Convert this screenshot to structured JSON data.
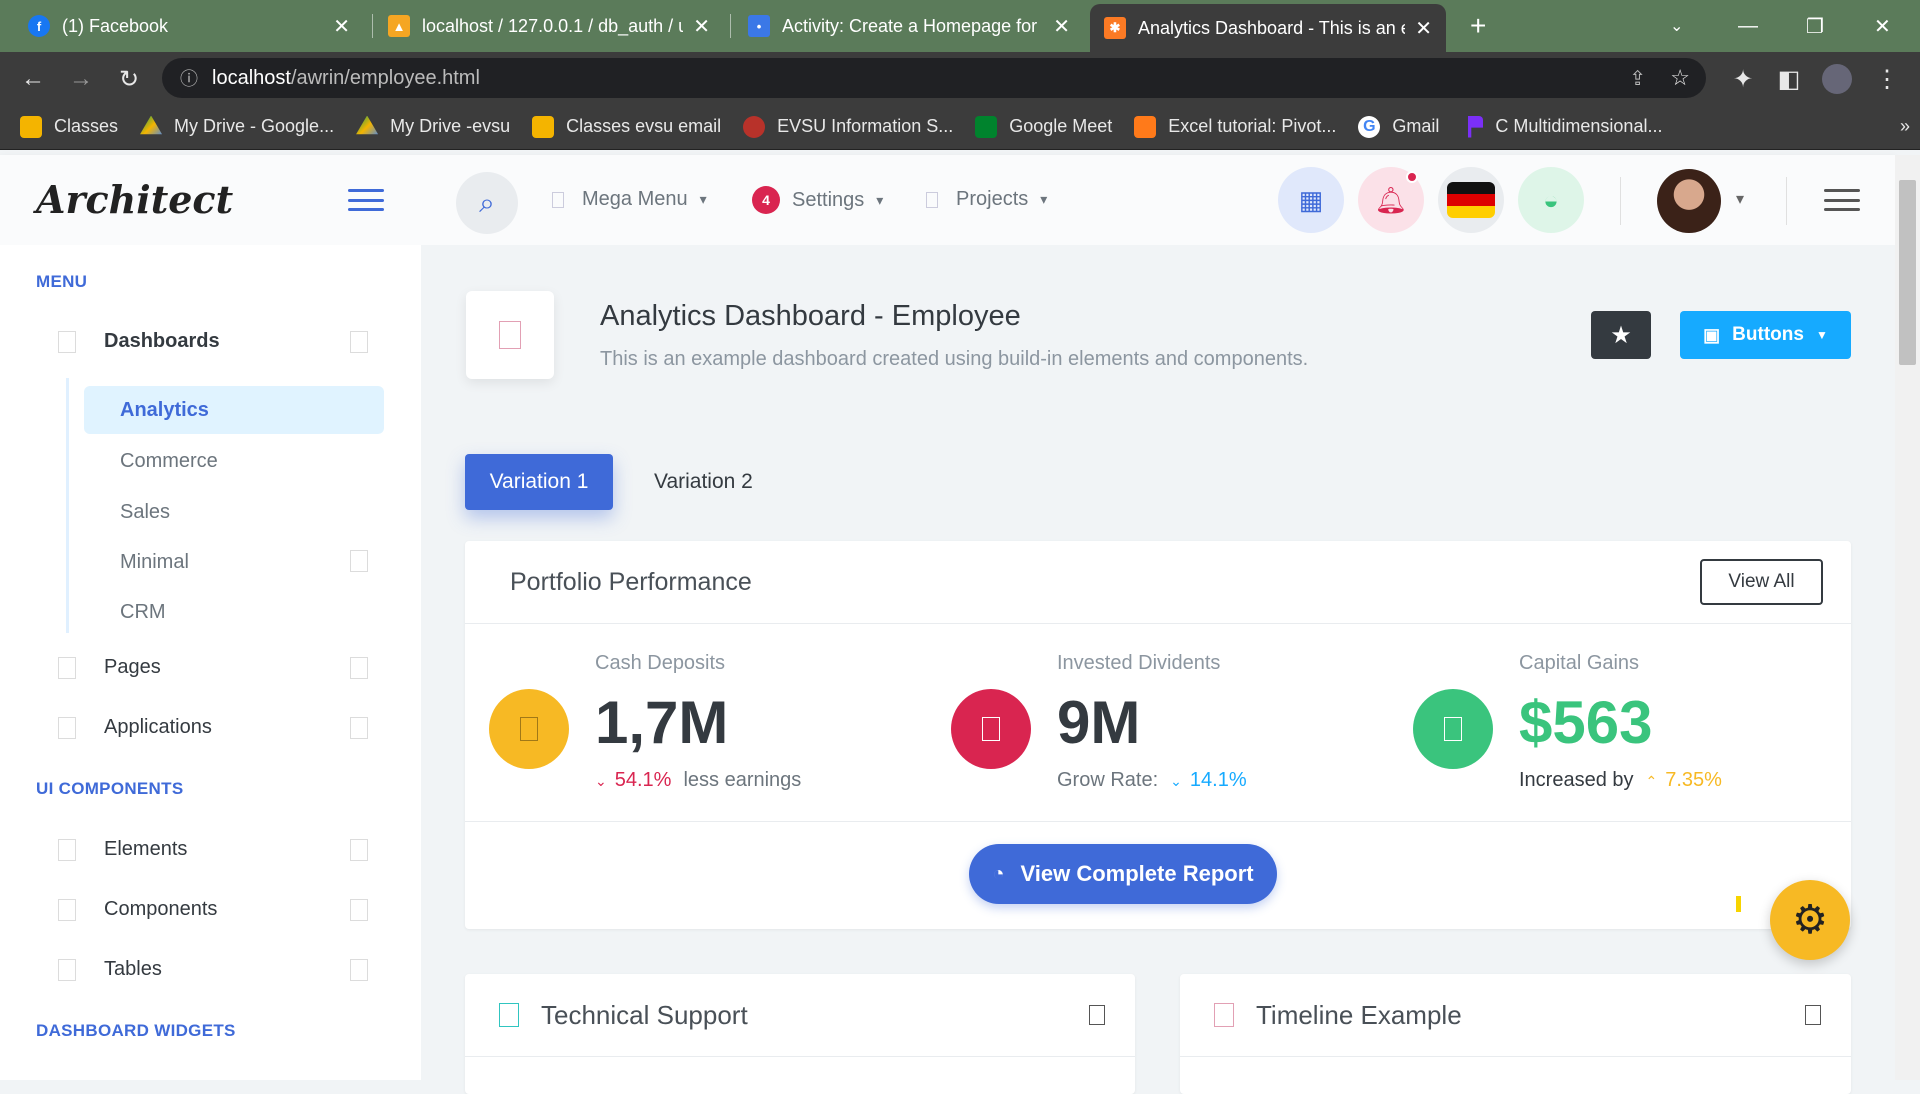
{
  "browser": {
    "tabs": [
      {
        "title": "(1) Facebook",
        "active": false
      },
      {
        "title": "localhost / 127.0.0.1 / db_auth / u",
        "active": false
      },
      {
        "title": "Activity: Create a Homepage for I",
        "active": false
      },
      {
        "title": "Analytics Dashboard - This is an e",
        "active": true
      }
    ],
    "new_tab": "+",
    "url_host": "localhost",
    "url_path": "/awrin/employee.html",
    "bookmarks": [
      "Classes",
      "My Drive - Google...",
      "My Drive -evsu",
      "Classes evsu email",
      "EVSU Information S...",
      "Google Meet",
      "Excel tutorial: Pivot...",
      "Gmail",
      "C Multidimensional..."
    ],
    "bookmarks_more": "»"
  },
  "header": {
    "logo": "Architect",
    "nav": [
      {
        "label": "Mega Menu"
      },
      {
        "label": "Settings",
        "badge": "4"
      },
      {
        "label": "Projects"
      }
    ]
  },
  "sidebar": {
    "menu_heading": "MENU",
    "dashboards": "Dashboards",
    "sub_items": [
      "Analytics",
      "Commerce",
      "Sales",
      "Minimal",
      "CRM"
    ],
    "pages": "Pages",
    "applications": "Applications",
    "ui_heading": "UI COMPONENTS",
    "elements": "Elements",
    "components": "Components",
    "tables": "Tables",
    "widgets_heading": "DASHBOARD WIDGETS"
  },
  "page": {
    "title": "Analytics Dashboard - Employee",
    "subtitle": "This is an example dashboard created using build-in elements and components.",
    "buttons_label": "Buttons",
    "tab1": "Variation 1",
    "tab2": "Variation 2"
  },
  "portfolio": {
    "title": "Portfolio Performance",
    "view_all": "View All",
    "widgets": [
      {
        "label": "Cash Deposits",
        "value": "1,7M",
        "delta": "54.1%",
        "suffix": "less earnings",
        "color": "#f7b924"
      },
      {
        "label": "Invested Dividents",
        "value": "9M",
        "prefix": "Grow Rate:",
        "delta": "14.1%",
        "color": "#d92550"
      },
      {
        "label": "Capital Gains",
        "value": "$563",
        "prefix": "Increased by",
        "delta": "7.35%",
        "color": "#3ac47d"
      }
    ],
    "report_button": "View Complete Report"
  },
  "cards": {
    "tech_support": "Technical Support",
    "timeline": "Timeline Example"
  },
  "colors": {
    "primary": "#3f6ad8",
    "danger": "#d92550",
    "warning": "#f7b924",
    "success": "#3ac47d",
    "info": "#16aaff"
  }
}
